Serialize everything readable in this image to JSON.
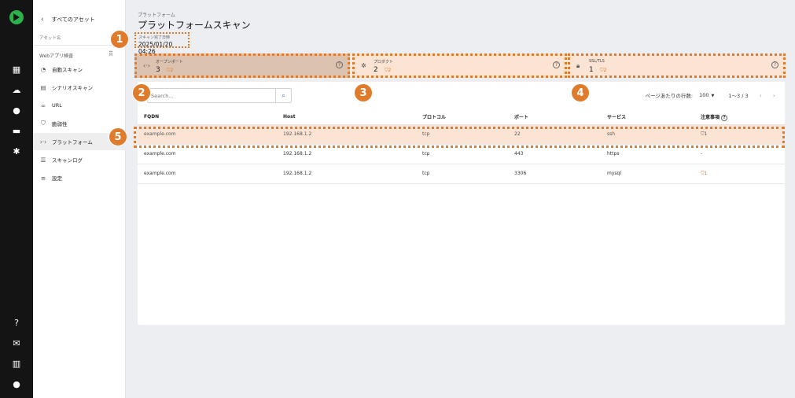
{
  "sidebar": {
    "back_label": "すべてのアセット",
    "asset_name": "アセット名",
    "group_label": "Webアプリ検査",
    "items": [
      {
        "label": "自動スキャン",
        "icon": "brain-icon"
      },
      {
        "label": "シナリオスキャン",
        "icon": "book-icon"
      },
      {
        "label": "URL",
        "icon": "link-icon"
      },
      {
        "label": "脆弱性",
        "icon": "shield-icon"
      },
      {
        "label": "プラットフォーム",
        "icon": "code-icon"
      },
      {
        "label": "スキャンログ",
        "icon": "log-icon"
      },
      {
        "label": "設定",
        "icon": "sliders-icon"
      }
    ]
  },
  "header": {
    "breadcrumb": "プラットフォーム",
    "title": "プラットフォームスキャン",
    "scan_label": "スキャン完了日時",
    "scan_value": "2025/01/20 04:26"
  },
  "cards": [
    {
      "label": "オープンポート",
      "value": "3",
      "warn": "2",
      "icon": "code-icon"
    },
    {
      "label": "プロダクト",
      "value": "2",
      "warn": "2",
      "icon": "gear-icon"
    },
    {
      "label": "SSL/TLS",
      "value": "1",
      "warn": "2",
      "icon": "lock-icon"
    }
  ],
  "search": {
    "placeholder": "Search…"
  },
  "pager": {
    "rows_per_page_label": "ページあたりの行数:",
    "rows_per_page": "100",
    "range": "1〜3 / 3"
  },
  "table": {
    "headers": [
      "FQDN",
      "Host",
      "プロトコル",
      "ポート",
      "サービス",
      "注意事項"
    ],
    "rows": [
      {
        "fqdn": "example.com",
        "host": "192.168.1.2",
        "protocol": "tcp",
        "port": "22",
        "service": "ssh",
        "note": "1"
      },
      {
        "fqdn": "example.com",
        "host": "192.168.1.2",
        "protocol": "tcp",
        "port": "443",
        "service": "https",
        "note": "-"
      },
      {
        "fqdn": "example.com",
        "host": "192.168.1.2",
        "protocol": "tcp",
        "port": "3306",
        "service": "mysql",
        "note": "1"
      }
    ]
  },
  "callouts": [
    "1",
    "2",
    "3",
    "4",
    "5"
  ],
  "colors": {
    "accent": "#e07b2c",
    "rail": "#141414",
    "link": "#1b6fd1"
  }
}
